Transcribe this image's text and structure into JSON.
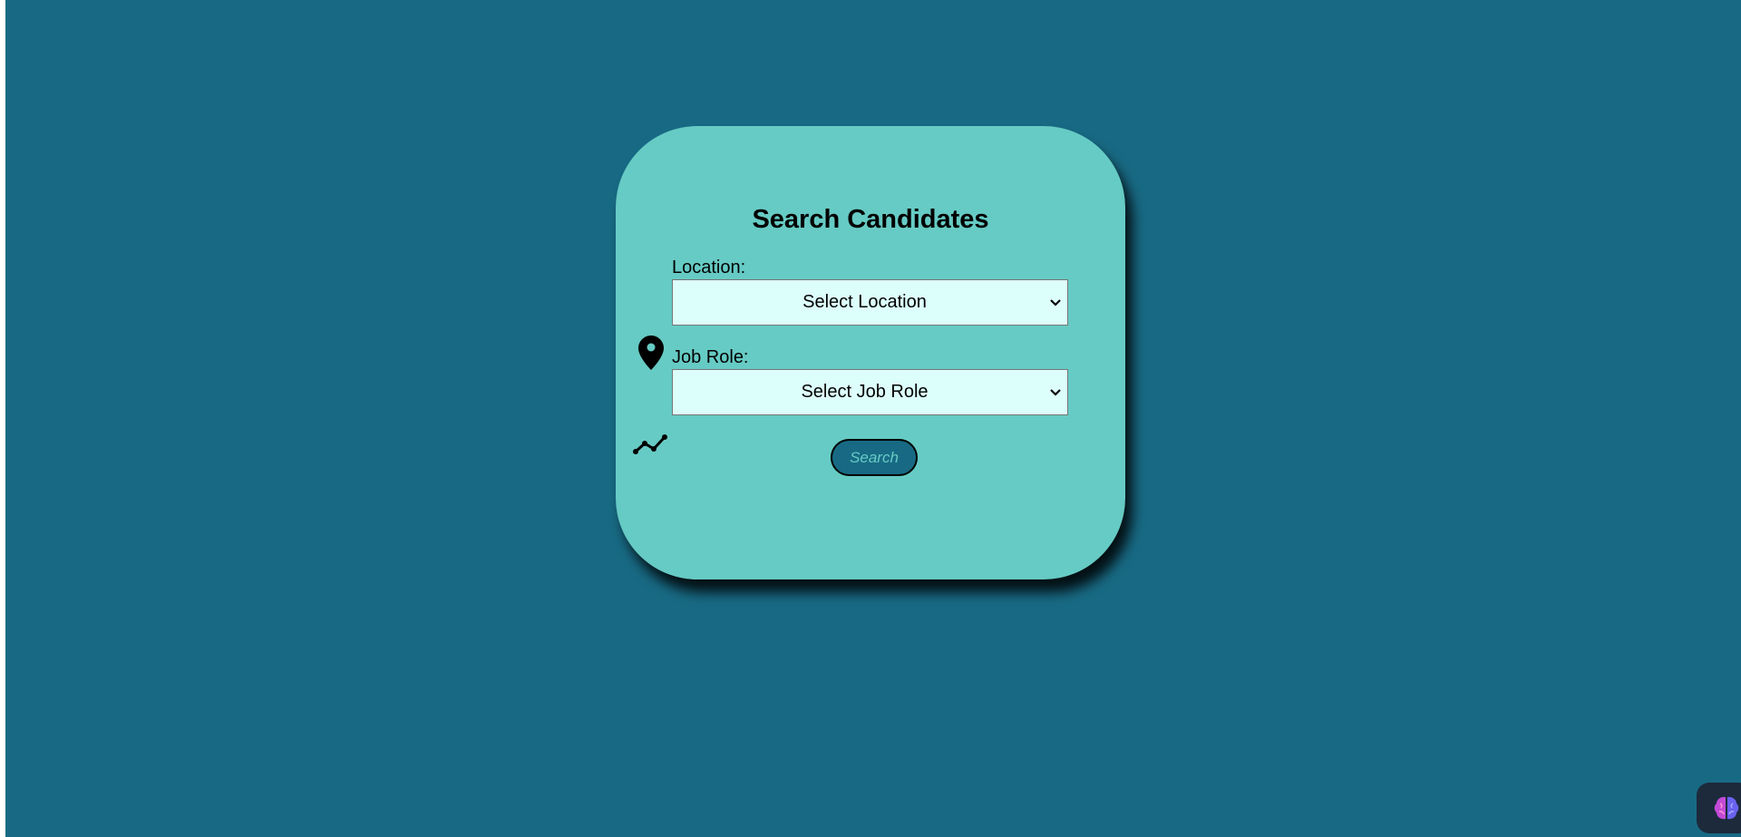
{
  "page": {
    "background_color": "#186a84",
    "card_color": "#66cbc4"
  },
  "form": {
    "title": "Search Candidates",
    "location_label": "Location:",
    "location_value": "Select Location",
    "job_role_label": "Job Role:",
    "job_role_value": "Select Job Role",
    "search_label": "Search"
  },
  "icons": {
    "location": "map-pin-icon",
    "job_role": "trend-line-icon",
    "widget": "brain-icon"
  }
}
